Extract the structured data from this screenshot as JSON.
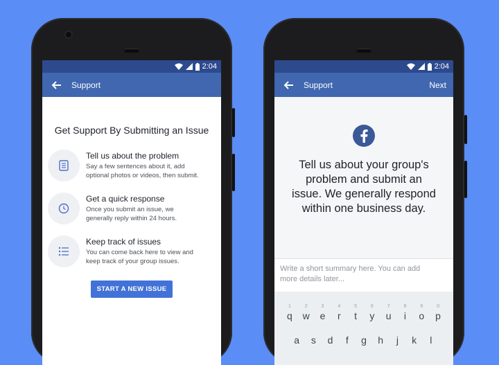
{
  "status": {
    "time": "2:04"
  },
  "left": {
    "appbar_title": "Support",
    "heading": "Get Support By Submitting an Issue",
    "items": [
      {
        "icon": "document-icon",
        "title": "Tell us about the problem",
        "desc1": "Say a few sentences about it, add",
        "desc2": "optional photos or videos, then submit."
      },
      {
        "icon": "clock-icon",
        "title": "Get a quick response",
        "desc1": "Once you submit an issue, we",
        "desc2": "generally reply within 24 hours."
      },
      {
        "icon": "list-icon",
        "title": "Keep track of issues",
        "desc1": "You can come back here to view and",
        "desc2": "keep track of your group issues."
      }
    ],
    "button_label": "START A NEW ISSUE"
  },
  "right": {
    "appbar_title": "Support",
    "next_label": "Next",
    "logo_icon": "facebook-logo-icon",
    "message_lines": [
      "Tell us about your group's",
      "problem and submit an",
      "issue. We generally respond",
      "within one business day."
    ],
    "summary_placeholder_1": "Write a short summary here. You can add",
    "summary_placeholder_2": "more details later...",
    "keyboard": {
      "row1": [
        "q",
        "w",
        "e",
        "r",
        "t",
        "y",
        "u",
        "i",
        "o",
        "p"
      ],
      "row1_numbers": [
        "1",
        "2",
        "3",
        "4",
        "5",
        "6",
        "7",
        "8",
        "9",
        "0"
      ],
      "row2": [
        "a",
        "s",
        "d",
        "f",
        "g",
        "h",
        "j",
        "k",
        "l"
      ]
    }
  },
  "colors": {
    "background": "#5a8df5",
    "appbar": "#4067b0",
    "statusbar": "#2d4a8f",
    "button": "#4272d7",
    "facebook": "#3b5998"
  }
}
